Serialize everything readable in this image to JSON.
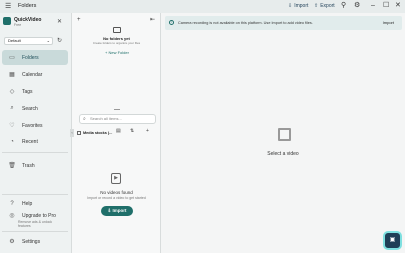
{
  "window": {
    "title": "Folders",
    "import_label": "Import",
    "export_label": "Export"
  },
  "sidebar": {
    "app_name": "QuickVideo",
    "plan": "Free",
    "profile": "Default",
    "items": [
      {
        "label": "Folders",
        "icon": "folder-icon"
      },
      {
        "label": "Calendar",
        "icon": "calendar-icon"
      },
      {
        "label": "Tags",
        "icon": "tag-icon"
      },
      {
        "label": "Search",
        "icon": "search-icon"
      },
      {
        "label": "Favorites",
        "icon": "heart-icon"
      },
      {
        "label": "Recent",
        "icon": "clock-icon"
      },
      {
        "label": "Trash",
        "icon": "trash-icon"
      },
      {
        "label": "Help",
        "icon": "help-icon"
      },
      {
        "label": "Upgrade to Pro",
        "icon": "upgrade-icon"
      },
      {
        "label": "Settings",
        "icon": "gear-icon"
      }
    ],
    "upgrade_sub": "Remove ads & unlock features"
  },
  "folders_panel": {
    "empty_title": "No folders yet",
    "empty_sub": "Create folders to organize your files",
    "new_folder_label": "New Folder"
  },
  "videos_panel": {
    "search_placeholder": "Search all items...",
    "media_label": "Media stocks (...",
    "empty_title": "No videos found",
    "empty_sub": "Import or record a video to get started",
    "import_label": "Import"
  },
  "main": {
    "banner_message": "Camera recording is not available on this platform. Use Import to add video files.",
    "banner_import": "Import",
    "placeholder": "Select a video"
  },
  "colors": {
    "accent": "#1f6f6a",
    "active_nav": "#c9dada",
    "fab": "#1f3f57"
  }
}
